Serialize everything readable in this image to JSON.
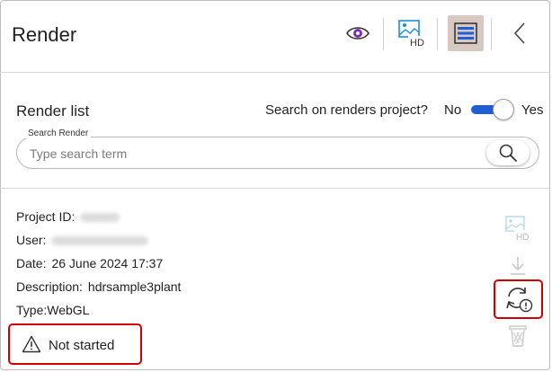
{
  "header": {
    "title": "Render",
    "icons": [
      "eye-icon",
      "image-hd-icon",
      "list-icon",
      "chevron-left-icon"
    ],
    "hd_badge": "HD"
  },
  "render_list": {
    "title": "Render list",
    "toggle_question": "Search on renders project?",
    "toggle_no": "No",
    "toggle_yes": "Yes",
    "toggle_on": true,
    "accent_color": "#1f5fd6"
  },
  "search": {
    "legend": "Search Render",
    "placeholder": "Type search term"
  },
  "item": {
    "project_id_label": "Project ID:",
    "user_label": "User:",
    "date_label": "Date:",
    "date_value": "26 June 2024 17:37",
    "description_label": "Description:",
    "description_value": "hdrsample3plant",
    "type_label": "Type:",
    "type_value": "WebGL",
    "status": "Not started",
    "hd_badge": "HD"
  },
  "highlight_color": "#d00000"
}
